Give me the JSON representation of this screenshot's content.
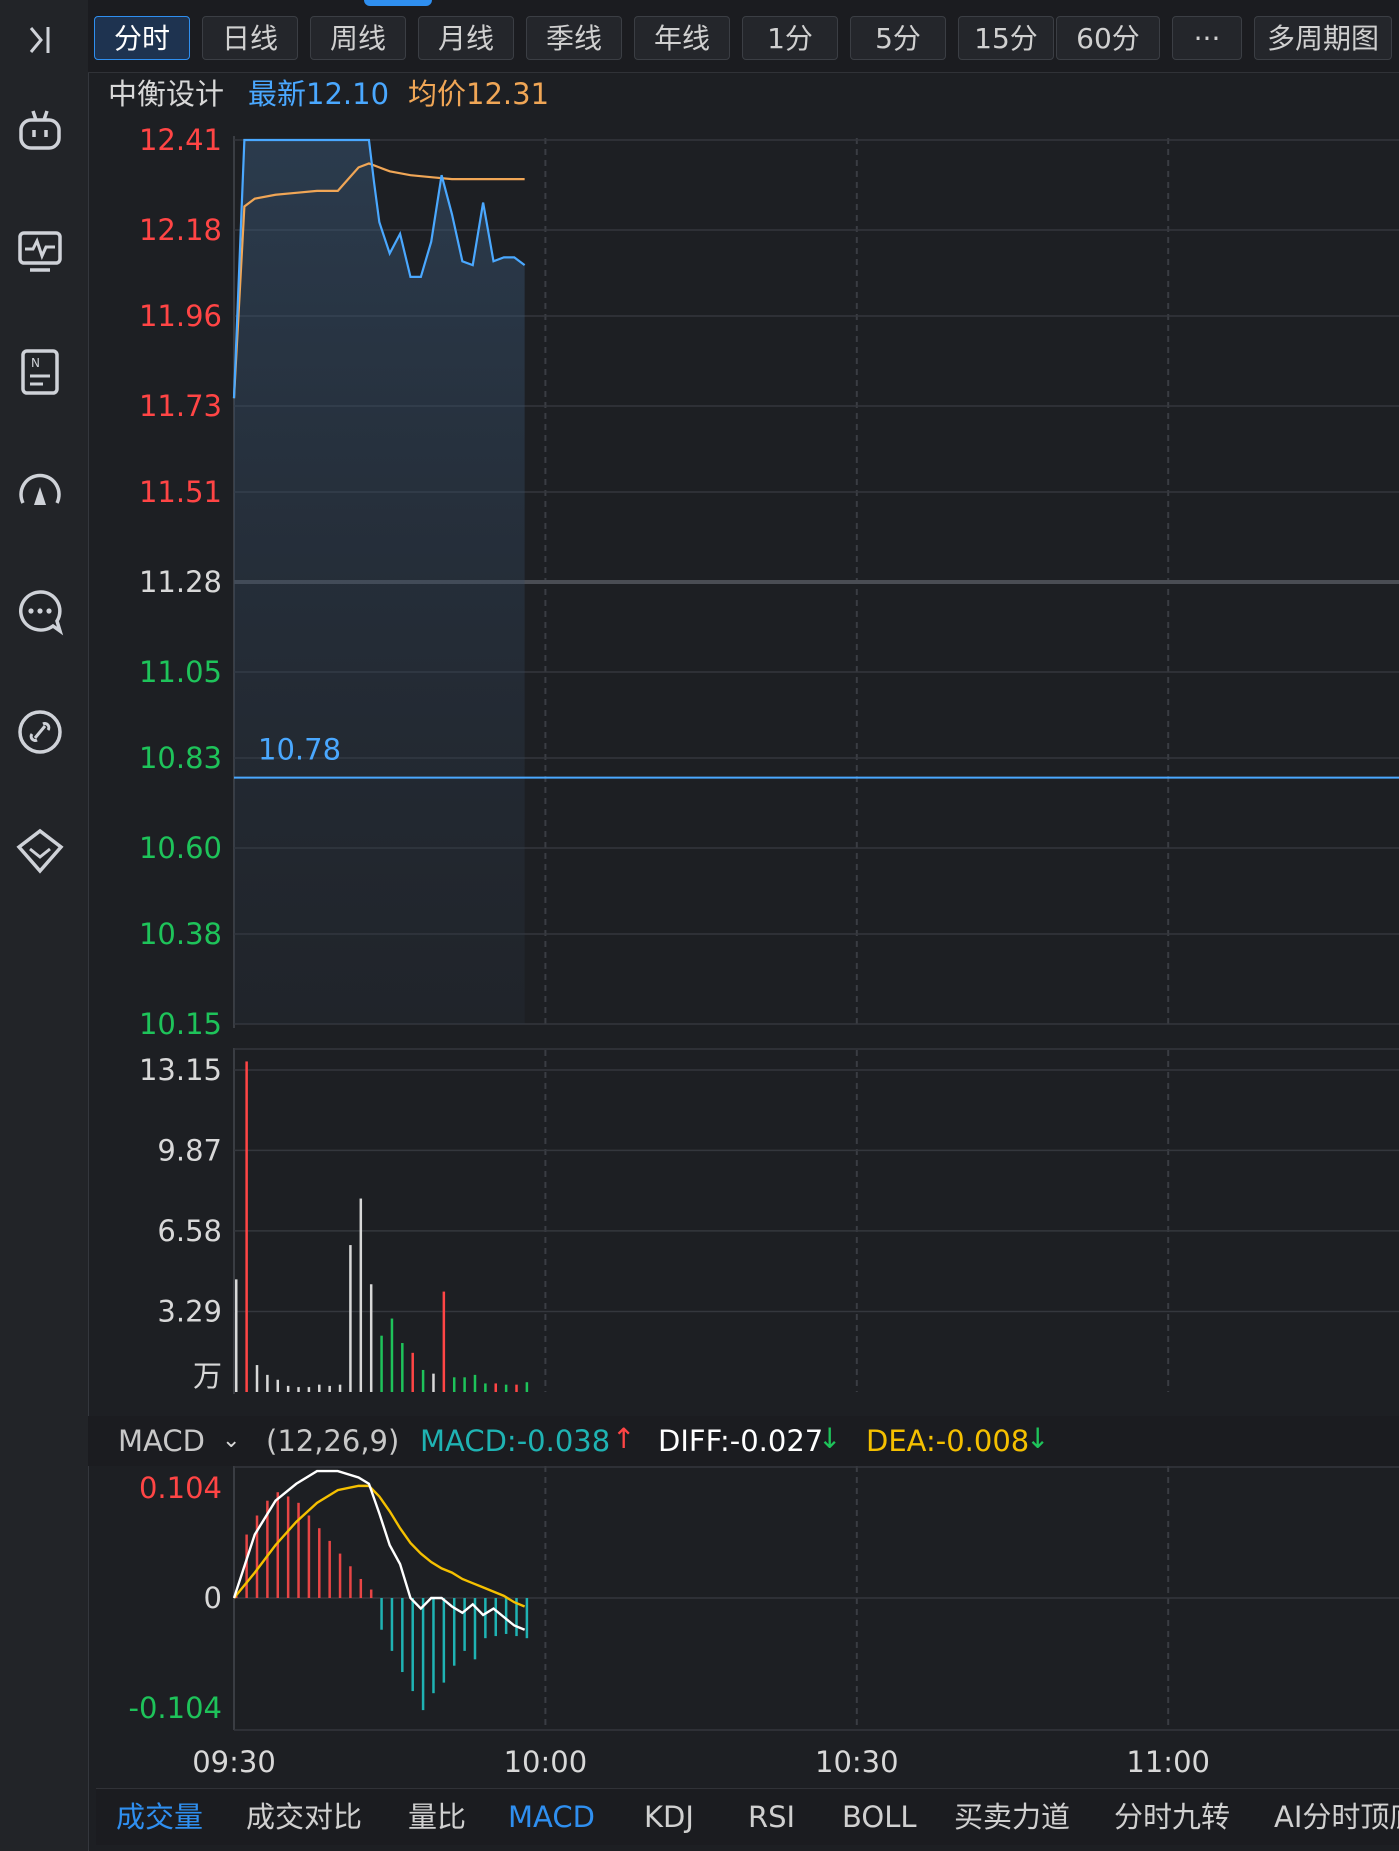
{
  "periods": [
    "分时",
    "日线",
    "周线",
    "月线",
    "季线",
    "年线",
    "1分",
    "5分",
    "15分",
    "60分",
    "···",
    "多周期图"
  ],
  "active_period": 0,
  "info": {
    "name": "中衡设计",
    "latest_label": "最新12.10",
    "avg_label": "均价12.31"
  },
  "macd_header": {
    "name": "MACD",
    "params": "(12,26,9)",
    "macd": "MACD:-0.038",
    "diff": "DIFF:-0.027",
    "dea": "DEA:-0.008"
  },
  "bottom_tabs": [
    "成交量",
    "成交对比",
    "量比",
    "MACD",
    "KDJ",
    "RSI",
    "BOLL",
    "买卖力道",
    "分时九转",
    "AI分时顶底"
  ],
  "active_bottom_tabs": [
    0,
    3
  ],
  "colors": {
    "up": "#ff4545",
    "down": "#1ec35a",
    "neutral": "#d8d8d8",
    "price_line": "#4aa8ff",
    "avg_line": "#f0a656",
    "macd_pos": "#e84545",
    "macd_neg": "#1fb3b3",
    "diff_line": "#ffffff",
    "dea_line": "#f5c000",
    "accent": "#2f8ff0"
  },
  "chart_data": [
    {
      "type": "line",
      "name": "price",
      "y_ticks": [
        "12.41",
        "12.18",
        "11.96",
        "11.73",
        "11.51",
        "11.28",
        "11.05",
        "10.83",
        "10.60",
        "10.38",
        "10.15"
      ],
      "ylim": [
        10.15,
        12.41
      ],
      "reference_price": 11.28,
      "marker_label": "10.78",
      "marker_value": 10.78,
      "x_labels": [
        "09:30",
        "10:00",
        "10:30",
        "11:00"
      ],
      "x_range_minutes": [
        0,
        100
      ],
      "series": [
        {
          "name": "最新",
          "x": [
            0,
            1,
            3,
            5,
            7,
            9,
            11,
            13,
            13.5,
            14,
            15,
            16,
            17,
            18,
            19,
            20,
            21,
            22,
            23,
            24,
            25,
            26,
            27,
            28
          ],
          "values": [
            11.75,
            12.41,
            12.41,
            12.41,
            12.41,
            12.41,
            12.41,
            12.41,
            12.3,
            12.2,
            12.12,
            12.17,
            12.06,
            12.06,
            12.15,
            12.32,
            12.22,
            12.1,
            12.09,
            12.25,
            12.1,
            12.11,
            12.11,
            12.09
          ]
        },
        {
          "name": "均价",
          "x": [
            0,
            1,
            2,
            4,
            6,
            8,
            10,
            11,
            12,
            13,
            14,
            15,
            17,
            19,
            21,
            23,
            25,
            28
          ],
          "values": [
            11.75,
            12.24,
            12.26,
            12.27,
            12.275,
            12.28,
            12.28,
            12.31,
            12.34,
            12.35,
            12.34,
            12.33,
            12.32,
            12.315,
            12.31,
            12.31,
            12.31,
            12.31
          ]
        }
      ]
    },
    {
      "type": "bar",
      "name": "volume",
      "y_ticks": [
        "13.15",
        "9.87",
        "6.58",
        "3.29"
      ],
      "unit": "万",
      "ylim": [
        0,
        13.15
      ],
      "x": [
        0,
        1,
        2,
        3,
        4,
        5,
        6,
        7,
        8,
        9,
        10,
        11,
        12,
        13,
        14,
        15,
        16,
        17,
        18,
        19,
        20,
        21,
        22,
        23,
        24,
        25,
        26,
        27,
        28
      ],
      "values": [
        4.6,
        13.5,
        1.1,
        0.7,
        0.5,
        0.25,
        0.2,
        0.2,
        0.3,
        0.25,
        0.3,
        6.0,
        7.9,
        4.4,
        2.3,
        3.0,
        2.0,
        1.6,
        0.9,
        0.75,
        4.1,
        0.6,
        0.6,
        0.7,
        0.35,
        0.35,
        0.3,
        0.3,
        0.4
      ],
      "colors": [
        "neutral",
        "up",
        "neutral",
        "neutral",
        "neutral",
        "neutral",
        "neutral",
        "neutral",
        "neutral",
        "neutral",
        "neutral",
        "neutral",
        "neutral",
        "neutral",
        "down",
        "down",
        "down",
        "up",
        "down",
        "neutral",
        "up",
        "down",
        "down",
        "down",
        "down",
        "up",
        "down",
        "up",
        "down"
      ]
    },
    {
      "type": "bar",
      "name": "MACD",
      "y_ticks": [
        "0.104",
        "0",
        "-0.104"
      ],
      "ylim": [
        -0.118,
        0.118
      ],
      "x": [
        0,
        1,
        2,
        3,
        4,
        5,
        6,
        7,
        8,
        9,
        10,
        11,
        12,
        13,
        14,
        15,
        16,
        17,
        18,
        19,
        20,
        21,
        22,
        23,
        24,
        25,
        26,
        27,
        28
      ],
      "values": [
        0.005,
        0.06,
        0.078,
        0.092,
        0.1,
        0.096,
        0.09,
        0.078,
        0.066,
        0.054,
        0.042,
        0.03,
        0.018,
        0.008,
        -0.03,
        -0.05,
        -0.07,
        -0.088,
        -0.106,
        -0.09,
        -0.08,
        -0.064,
        -0.05,
        -0.058,
        -0.038,
        -0.036,
        -0.034,
        -0.036,
        -0.038
      ],
      "series": [
        {
          "name": "DIFF",
          "x": [
            0,
            2,
            4,
            6,
            8,
            10,
            12,
            13,
            14,
            15,
            16,
            17,
            18,
            19,
            20,
            21,
            22,
            23,
            24,
            25,
            26,
            27,
            28
          ],
          "values": [
            0.0,
            0.06,
            0.092,
            0.108,
            0.12,
            0.12,
            0.114,
            0.108,
            0.08,
            0.05,
            0.032,
            0.0,
            -0.01,
            0.0,
            0.0,
            -0.008,
            -0.014,
            -0.006,
            -0.016,
            -0.01,
            -0.018,
            -0.026,
            -0.03
          ]
        },
        {
          "name": "DEA",
          "x": [
            0,
            2,
            4,
            6,
            8,
            10,
            12,
            13,
            14,
            15,
            16,
            17,
            18,
            19,
            20,
            21,
            22,
            23,
            24,
            25,
            26,
            27,
            28
          ],
          "values": [
            0.0,
            0.024,
            0.05,
            0.072,
            0.09,
            0.102,
            0.106,
            0.106,
            0.096,
            0.082,
            0.066,
            0.052,
            0.042,
            0.034,
            0.028,
            0.024,
            0.018,
            0.014,
            0.01,
            0.006,
            0.002,
            -0.004,
            -0.008
          ]
        }
      ]
    }
  ]
}
